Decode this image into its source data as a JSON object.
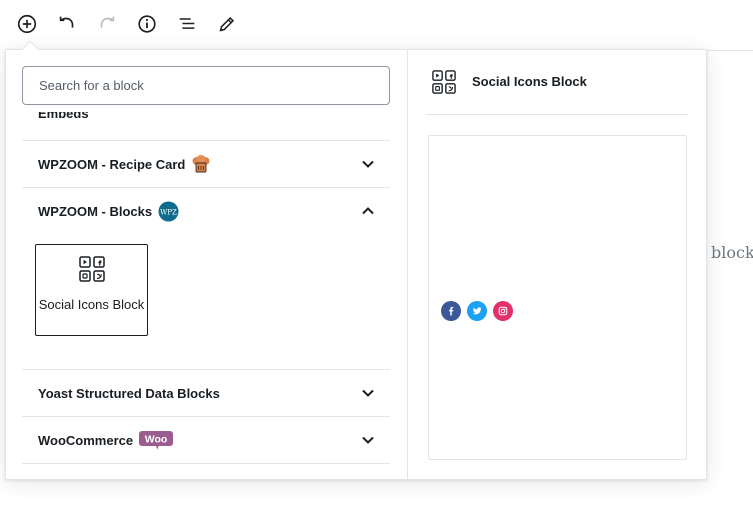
{
  "toolbar": {
    "buttons": [
      "add-block-icon",
      "undo-icon",
      "redo-icon",
      "info-icon",
      "list-view-icon",
      "edit-icon"
    ]
  },
  "inserter": {
    "search": {
      "placeholder": "Search for a block",
      "value": ""
    },
    "partial_category_label": "Embeds",
    "categories": [
      {
        "label": "WPZOOM - Recipe Card",
        "icon": "chef-hat-icon",
        "expanded": false
      },
      {
        "label": "WPZOOM - Blocks",
        "icon": "wpz-badge-icon",
        "icon_text": "WPZ",
        "expanded": true,
        "blocks": [
          {
            "label": "Social Icons Block",
            "icon": "social-icons-block-icon"
          }
        ]
      },
      {
        "label": "Yoast Structured Data Blocks",
        "expanded": false
      },
      {
        "label": "WooCommerce",
        "icon": "woo-logo-icon",
        "icon_text": "Woo",
        "expanded": false
      }
    ]
  },
  "preview": {
    "title": "Social Icons Block",
    "icons": [
      "facebook-icon",
      "twitter-icon",
      "instagram-icon"
    ],
    "colors": {
      "facebook": "#3b5998",
      "twitter": "#1da1f2",
      "instagram": "#e1306c"
    }
  },
  "background_text": "block"
}
